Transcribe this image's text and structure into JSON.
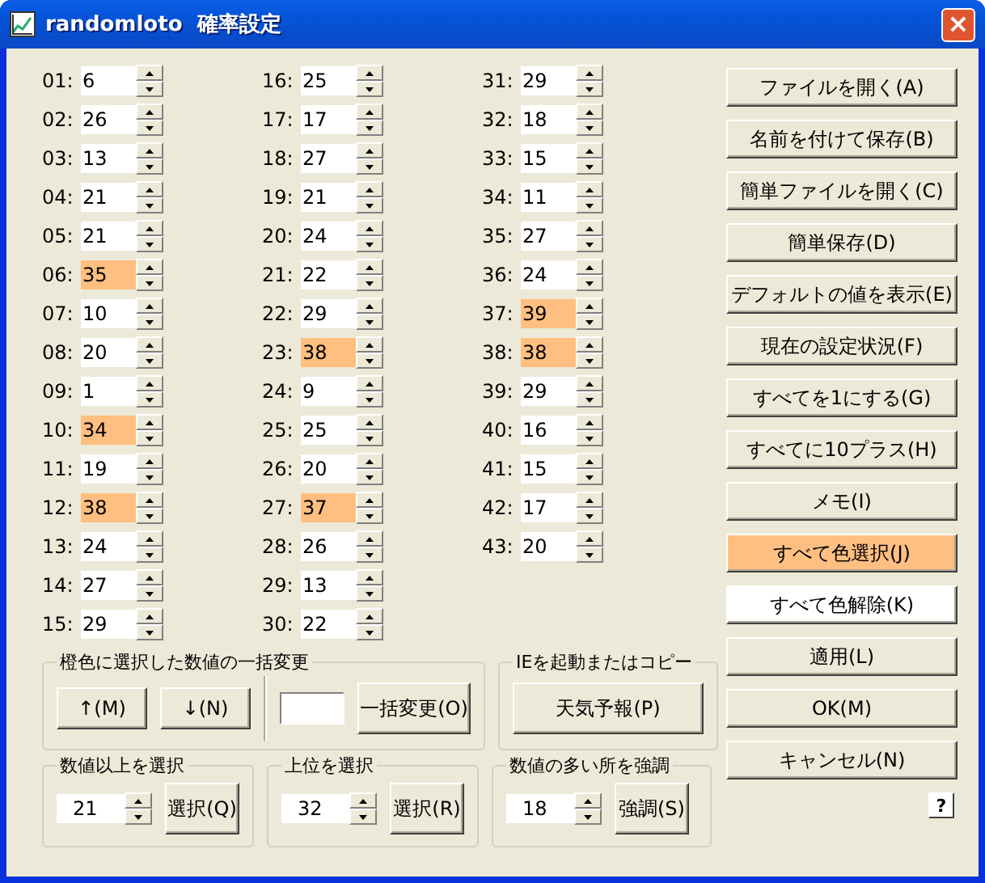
{
  "window": {
    "title": "randomloto  確率設定",
    "close": "×"
  },
  "number_columns": [
    [
      {
        "label": "01:",
        "value": "6",
        "highlighted": false
      },
      {
        "label": "02:",
        "value": "26",
        "highlighted": false
      },
      {
        "label": "03:",
        "value": "13",
        "highlighted": false
      },
      {
        "label": "04:",
        "value": "21",
        "highlighted": false
      },
      {
        "label": "05:",
        "value": "21",
        "highlighted": false
      },
      {
        "label": "06:",
        "value": "35",
        "highlighted": true
      },
      {
        "label": "07:",
        "value": "10",
        "highlighted": false
      },
      {
        "label": "08:",
        "value": "20",
        "highlighted": false
      },
      {
        "label": "09:",
        "value": "1",
        "highlighted": false
      },
      {
        "label": "10:",
        "value": "34",
        "highlighted": true
      },
      {
        "label": "11:",
        "value": "19",
        "highlighted": false
      },
      {
        "label": "12:",
        "value": "38",
        "highlighted": true
      },
      {
        "label": "13:",
        "value": "24",
        "highlighted": false
      },
      {
        "label": "14:",
        "value": "27",
        "highlighted": false
      },
      {
        "label": "15:",
        "value": "29",
        "highlighted": false
      }
    ],
    [
      {
        "label": "16:",
        "value": "25",
        "highlighted": false
      },
      {
        "label": "17:",
        "value": "17",
        "highlighted": false
      },
      {
        "label": "18:",
        "value": "27",
        "highlighted": false
      },
      {
        "label": "19:",
        "value": "21",
        "highlighted": false
      },
      {
        "label": "20:",
        "value": "24",
        "highlighted": false
      },
      {
        "label": "21:",
        "value": "22",
        "highlighted": false
      },
      {
        "label": "22:",
        "value": "29",
        "highlighted": false
      },
      {
        "label": "23:",
        "value": "38",
        "highlighted": true
      },
      {
        "label": "24:",
        "value": "9",
        "highlighted": false
      },
      {
        "label": "25:",
        "value": "25",
        "highlighted": false
      },
      {
        "label": "26:",
        "value": "20",
        "highlighted": false
      },
      {
        "label": "27:",
        "value": "37",
        "highlighted": true
      },
      {
        "label": "28:",
        "value": "26",
        "highlighted": false
      },
      {
        "label": "29:",
        "value": "13",
        "highlighted": false
      },
      {
        "label": "30:",
        "value": "22",
        "highlighted": false
      }
    ],
    [
      {
        "label": "31:",
        "value": "29",
        "highlighted": false
      },
      {
        "label": "32:",
        "value": "18",
        "highlighted": false
      },
      {
        "label": "33:",
        "value": "15",
        "highlighted": false
      },
      {
        "label": "34:",
        "value": "11",
        "highlighted": false
      },
      {
        "label": "35:",
        "value": "27",
        "highlighted": false
      },
      {
        "label": "36:",
        "value": "24",
        "highlighted": false
      },
      {
        "label": "37:",
        "value": "39",
        "highlighted": true
      },
      {
        "label": "38:",
        "value": "38",
        "highlighted": true
      },
      {
        "label": "39:",
        "value": "29",
        "highlighted": false
      },
      {
        "label": "40:",
        "value": "16",
        "highlighted": false
      },
      {
        "label": "41:",
        "value": "15",
        "highlighted": false
      },
      {
        "label": "42:",
        "value": "17",
        "highlighted": false
      },
      {
        "label": "43:",
        "value": "20",
        "highlighted": false
      }
    ]
  ],
  "bulk_change": {
    "title": "橙色に選択した数値の一括変更",
    "up_button": "↑(M)",
    "down_button": "↓(N)",
    "apply_button": "一括変更(O)"
  },
  "ie_group": {
    "title": "IEを起動またはコピー",
    "button": "天気予報(P)"
  },
  "select_above": {
    "title": "数値以上を選択",
    "value": "21",
    "button": "選択(Q)"
  },
  "select_top": {
    "title": "上位を選択",
    "value": "32",
    "button": "選択(R)"
  },
  "emphasize": {
    "title": "数値の多い所を強調",
    "value": "18",
    "button": "強調(S)"
  },
  "side_buttons": [
    {
      "label": "ファイルを開く(A)",
      "color": "#ece9d8"
    },
    {
      "label": "名前を付けて保存(B)",
      "color": "#ece9d8"
    },
    {
      "label": "簡単ファイルを開く(C)",
      "color": "#ece9d8"
    },
    {
      "label": "簡単保存(D)",
      "color": "#ece9d8"
    },
    {
      "label": "デフォルトの値を表示(E)",
      "color": "#ece9d8"
    },
    {
      "label": "現在の設定状況(F)",
      "color": "#ece9d8"
    },
    {
      "label": "すべてを1にする(G)",
      "color": "#ece9d8"
    },
    {
      "label": "すべてに10プラス(H)",
      "color": "#ece9d8"
    },
    {
      "label": "メモ(I)",
      "color": "#ece9d8"
    },
    {
      "label": "すべて色選択(J)",
      "color": "#ffbf80"
    },
    {
      "label": "すべて色解除(K)",
      "color": "#ffffff"
    },
    {
      "label": "適用(L)",
      "color": "#ece9d8"
    },
    {
      "label": "OK(M)",
      "color": "#ece9d8"
    },
    {
      "label": "キャンセル(N)",
      "color": "#ece9d8"
    }
  ],
  "help_button": "?"
}
